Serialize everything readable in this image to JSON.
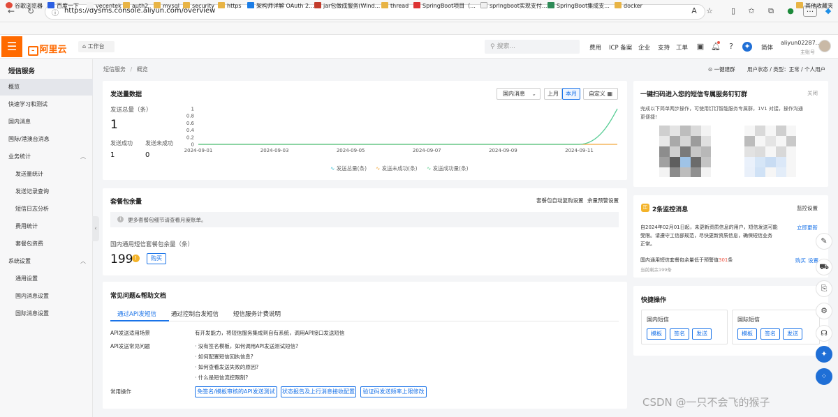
{
  "browser": {
    "url": "https://dysms.console.aliyun.com/overview",
    "bookmarks": [
      "谷歌浏览器",
      "百度一下",
      "vecentek",
      "auth2",
      "mysql",
      "security",
      "https",
      "架构师详解 OAuth 2...",
      "jar包做成服务(Wind...",
      "thread",
      "SpringBoot项目（...",
      "springboot实现支付...",
      "SpringBoot集成支...",
      "docker",
      "其他收藏夹"
    ]
  },
  "header": {
    "logo": "阿里云",
    "workbench": "工作台",
    "search_placeholder": "搜索...",
    "links": [
      "费用",
      "ICP 备案",
      "企业",
      "支持",
      "工单"
    ],
    "lang": "简体",
    "account": "aliyun02287...",
    "account_role": "主账号"
  },
  "sidebar": {
    "title": "短信服务",
    "items": [
      {
        "label": "概览",
        "active": true,
        "indent": false
      },
      {
        "label": "快速学习和测试",
        "indent": false
      },
      {
        "label": "国内消息",
        "indent": false
      },
      {
        "label": "国际/港澳台消息",
        "indent": false
      },
      {
        "label": "业务统计",
        "indent": false,
        "group": true
      },
      {
        "label": "发送量统计",
        "indent": true
      },
      {
        "label": "发送记录查询",
        "indent": true
      },
      {
        "label": "短信日志分析",
        "indent": true
      },
      {
        "label": "费用统计",
        "indent": true
      },
      {
        "label": "套餐包资费",
        "indent": true
      },
      {
        "label": "系统设置",
        "indent": false,
        "group": true
      },
      {
        "label": "通用设置",
        "indent": true
      },
      {
        "label": "国内消息设置",
        "indent": true
      },
      {
        "label": "国际消息设置",
        "indent": true
      }
    ]
  },
  "breadcrumb": [
    "短信服务",
    "概览"
  ],
  "topbar": {
    "join_group": "一键建群",
    "user_status": "用户状态 / 类型：正常 / 个人用户"
  },
  "send_card": {
    "title": "发送量数据",
    "region": "国内消息",
    "period_tabs": [
      "上月",
      "本月",
      "自定义"
    ],
    "total_label": "发送总量（条）",
    "total_value": "1",
    "success_label": "发送成功",
    "success_value": "1",
    "fail_label": "发送未成功",
    "fail_value": "0"
  },
  "chart_data": {
    "type": "line",
    "x": [
      "2024-09-01",
      "2024-09-02",
      "2024-09-03",
      "2024-09-04",
      "2024-09-05",
      "2024-09-06",
      "2024-09-07",
      "2024-09-08",
      "2024-09-09",
      "2024-09-10",
      "2024-09-11",
      "2024-09-12"
    ],
    "x_tick_labels": [
      "2024-09-01",
      "2024-09-03",
      "2024-09-05",
      "2024-09-07",
      "2024-09-09",
      "2024-09-11"
    ],
    "y_ticks": [
      "0",
      "0.2",
      "0.4",
      "0.6",
      "0.8",
      "1"
    ],
    "ylim": [
      0,
      1
    ],
    "series": [
      {
        "name": "发送总量(条)",
        "color": "#3ec1d3",
        "values": [
          0,
          0,
          0,
          0,
          0,
          0,
          0,
          0,
          0,
          0,
          0,
          1
        ]
      },
      {
        "name": "发送未成功(条)",
        "color": "#f2a73b",
        "values": [
          0,
          0,
          0,
          0,
          0,
          0,
          0,
          0,
          0,
          0,
          0,
          0
        ]
      },
      {
        "name": "发送成功量(条)",
        "color": "#5fcf8f",
        "values": [
          0,
          0,
          0,
          0,
          0,
          0,
          0,
          0,
          0,
          0,
          0,
          1
        ]
      }
    ],
    "legend_position": "bottom"
  },
  "package_card": {
    "title": "套餐包余量",
    "link_auto": "套餐包自动复购设置",
    "link_alert": "余量预警设置",
    "notice": "更多套餐包细节请查看月度账单。",
    "remain_label": "国内通用短信套餐包余量（条）",
    "remain_value": "199",
    "buy": "购买"
  },
  "faq_card": {
    "title": "常见问题&帮助文档",
    "tabs": [
      "通过API发短信",
      "通过控制台发短信",
      "短信服务计费说明"
    ],
    "rows": [
      {
        "label": "API发送适用场景",
        "items": [
          "有开发能力，将短信服务集成到自有系统，调用API接口发送短信"
        ]
      },
      {
        "label": "API发送常见问题",
        "items": [
          "· 没有签名模板，如何调用API发送测试短信?",
          "· 如何配置短信回执信息?",
          "· 如何查看发送失败的原因?",
          "· 什么是短信流控限制?"
        ]
      }
    ],
    "ops_label": "常用操作",
    "ops": [
      "免签名/模板审核的API发送测试",
      "状态报告及上行消息接收配置",
      "验证码发送频率上限修改"
    ]
  },
  "qr_card": {
    "title": "一键扫码进入您的短信专属服务钉钉群",
    "close": "关闭",
    "desc_1": "完成以下简单两步操作，可使用钉钉智能服务专属群，1V1 对接，操作沟通",
    "desc_2": "更便捷!"
  },
  "monitor_card": {
    "title": "2条监控消息",
    "settings": "监控设置",
    "msg1": [
      "自2024年02月01日起，未更新资质信息的用户，短信发送可能",
      "受限。请遵守工信部规范，尽快更新资质信息，确保短信业务",
      "正常。"
    ],
    "msg1_action": "立即更新",
    "msg2_prefix": "国内通用短信套餐包余量低于预警值",
    "msg2_value": "301",
    "msg2_suffix": "条",
    "msg2_sub": "当前剩余199条",
    "msg2_buy": "购买",
    "msg2_set": "设置"
  },
  "quick_card": {
    "title": "快捷操作",
    "domestic": "国内短信",
    "intl": "国际短信",
    "buttons": [
      "模板",
      "签名",
      "发送"
    ]
  },
  "watermark": "CSDN @一只不会飞的猴子"
}
